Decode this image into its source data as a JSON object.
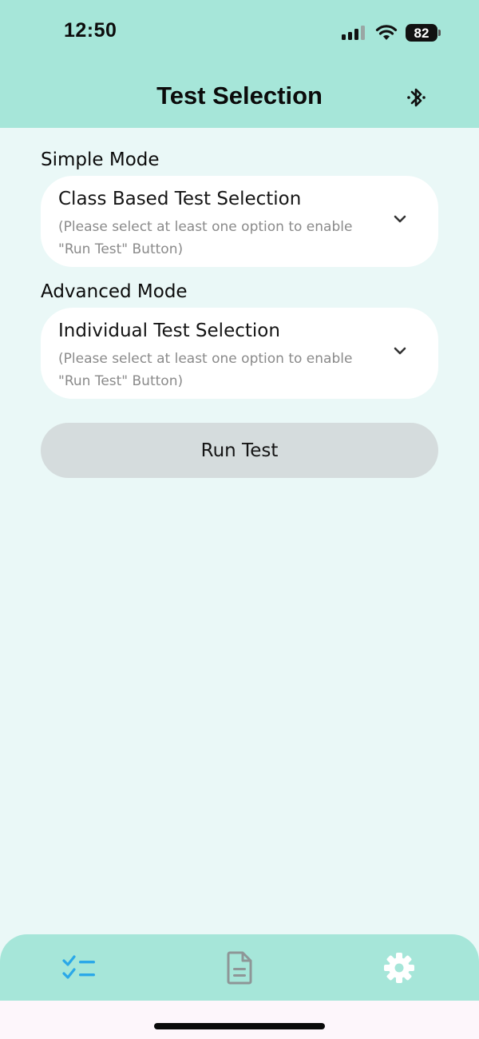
{
  "status_bar": {
    "time": "12:50",
    "battery_level": "82",
    "icons": [
      "signal-icon",
      "wifi-icon",
      "battery-icon"
    ]
  },
  "header": {
    "title": "Test Selection",
    "bluetooth_icon": "bluetooth-icon"
  },
  "simple_mode": {
    "label": "Simple Mode",
    "select": {
      "title": "Class Based Test Selection",
      "hint": "(Please select at least one option to enable \"Run Test\" Button)",
      "icon": "chevron-down-icon"
    }
  },
  "advanced_mode": {
    "label": "Advanced Mode",
    "select": {
      "title": "Individual Test Selection",
      "hint": "(Please select at least one option to enable \"Run Test\" Button)",
      "icon": "chevron-down-icon"
    }
  },
  "run_test_button": {
    "label": "Run Test",
    "enabled": false
  },
  "tab_bar": {
    "tabs": [
      {
        "icon": "checklist-icon",
        "active": true
      },
      {
        "icon": "document-icon",
        "active": false
      },
      {
        "icon": "gear-icon",
        "active": false
      }
    ]
  },
  "colors": {
    "header_bg": "#a6e6d9",
    "page_bg": "#eaf8f7",
    "card_bg": "#ffffff",
    "disabled_button_bg": "#d5dcdd",
    "active_tab_icon": "#2aa8e8",
    "inactive_tab_icon": "#8e9697",
    "settings_icon": "#ffffff"
  }
}
